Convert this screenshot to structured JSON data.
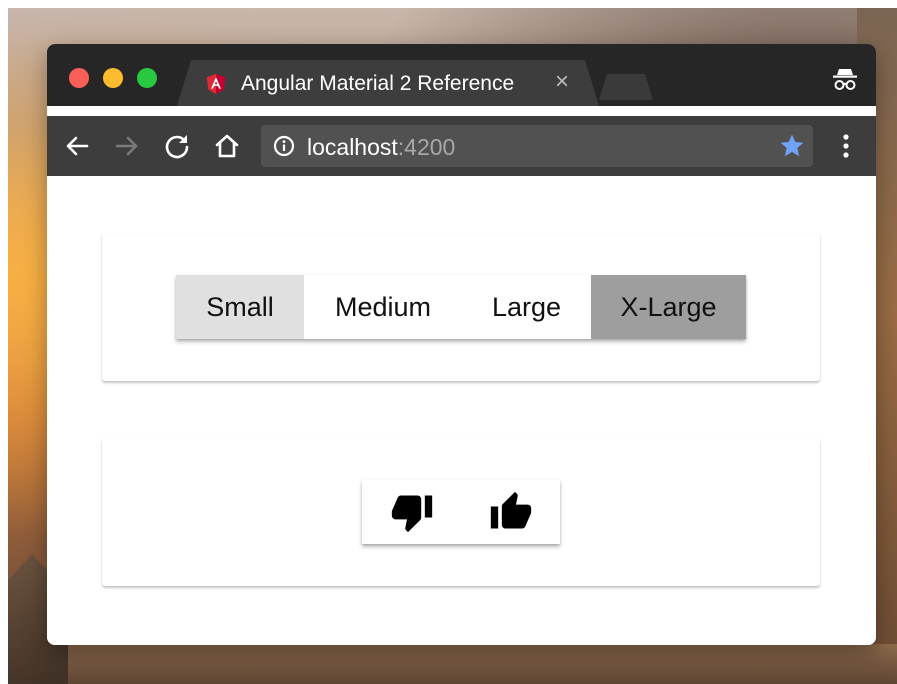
{
  "browser": {
    "tab": {
      "title": "Angular Material 2 Reference",
      "close_glyph": "×",
      "favicon": "angular-icon"
    },
    "address_bar": {
      "host": "localhost",
      "port": ":4200"
    },
    "icons": {
      "back": "arrow-back-icon",
      "forward": "arrow-forward-icon",
      "reload": "reload-icon",
      "home": "home-icon",
      "info": "info-icon",
      "bookmark": "star-icon",
      "menu": "more-vert-icon",
      "incognito": "incognito-icon"
    },
    "colors": {
      "close": "#fc5f57",
      "minimize": "#fdbc2e",
      "maximize": "#28c840",
      "star": "#6fa3f7"
    }
  },
  "size_toggle_group": {
    "buttons": [
      {
        "label": "Small",
        "state": "hover"
      },
      {
        "label": "Medium",
        "state": "normal"
      },
      {
        "label": "Large",
        "state": "normal"
      },
      {
        "label": "X-Large",
        "state": "selected"
      }
    ]
  },
  "rating_toggle_group": {
    "buttons": [
      {
        "icon": "thumb-down-icon"
      },
      {
        "icon": "thumb-up-icon"
      }
    ]
  }
}
